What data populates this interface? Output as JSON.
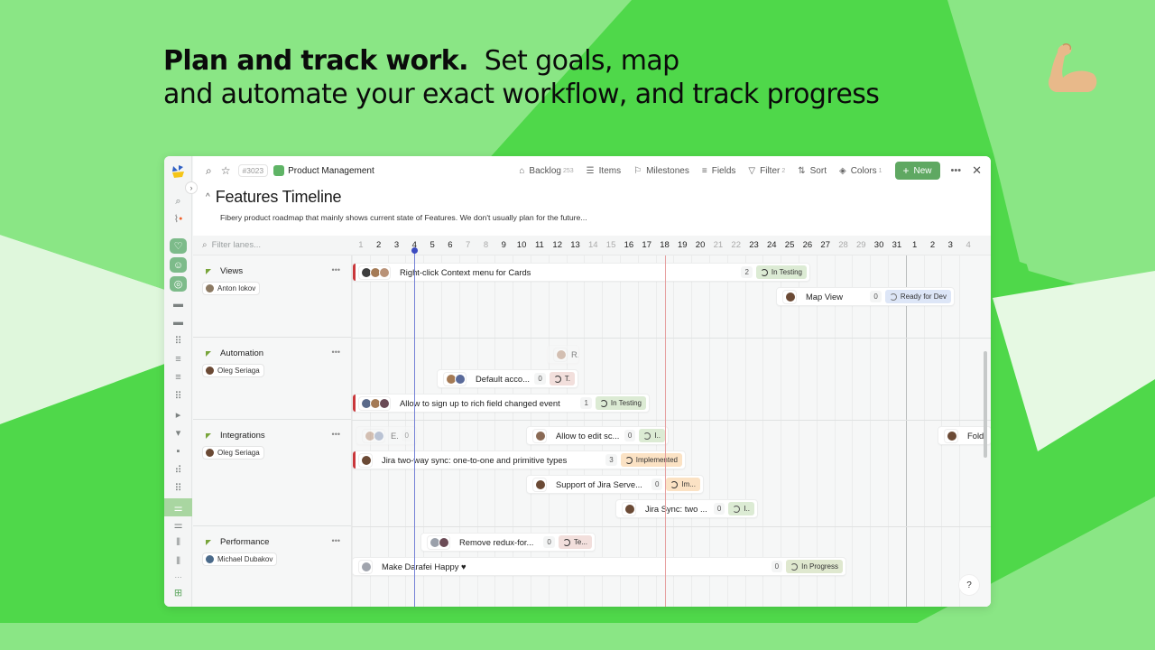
{
  "hero": {
    "bold": "Plan and track work.",
    "line1_rest": "  Set goals, map",
    "line2": "and automate your exact workflow, and track progress",
    "emoji": "flexed-biceps"
  },
  "topbar": {
    "id_chip": "#3023",
    "space": "Product Management",
    "tools": [
      {
        "label": "Backlog",
        "count": "253",
        "icon": "inbox-icon"
      },
      {
        "label": "Items",
        "count": "",
        "icon": "items-icon"
      },
      {
        "label": "Milestones",
        "count": "",
        "icon": "flag-icon"
      },
      {
        "label": "Fields",
        "count": "",
        "icon": "fields-icon"
      },
      {
        "label": "Filter",
        "count": "2",
        "icon": "filter-icon"
      },
      {
        "label": "Sort",
        "count": "",
        "icon": "sort-icon"
      },
      {
        "label": "Colors",
        "count": "1",
        "icon": "paint-bucket-icon"
      }
    ],
    "new_label": "New",
    "accent": "#5fa862"
  },
  "view": {
    "title": "Features Timeline",
    "description": "Fibery product roadmap that mainly shows current state of Features. We don't usually plan for the future..."
  },
  "timeline": {
    "filter_placeholder": "Filter lanes...",
    "days": [
      {
        "d": "1",
        "w": true
      },
      {
        "d": "2",
        "w": false
      },
      {
        "d": "3",
        "w": false
      },
      {
        "d": "4",
        "w": false
      },
      {
        "d": "5",
        "w": false
      },
      {
        "d": "6",
        "w": false
      },
      {
        "d": "7",
        "w": true
      },
      {
        "d": "8",
        "w": true
      },
      {
        "d": "9",
        "w": false
      },
      {
        "d": "10",
        "w": false
      },
      {
        "d": "11",
        "w": false
      },
      {
        "d": "12",
        "w": false
      },
      {
        "d": "13",
        "w": false
      },
      {
        "d": "14",
        "w": true
      },
      {
        "d": "15",
        "w": true
      },
      {
        "d": "16",
        "w": false
      },
      {
        "d": "17",
        "w": false
      },
      {
        "d": "18",
        "w": false
      },
      {
        "d": "19",
        "w": false
      },
      {
        "d": "20",
        "w": false
      },
      {
        "d": "21",
        "w": true
      },
      {
        "d": "22",
        "w": true
      },
      {
        "d": "23",
        "w": false
      },
      {
        "d": "24",
        "w": false
      },
      {
        "d": "25",
        "w": false
      },
      {
        "d": "26",
        "w": false
      },
      {
        "d": "27",
        "w": false
      },
      {
        "d": "28",
        "w": true
      },
      {
        "d": "29",
        "w": true
      },
      {
        "d": "30",
        "w": false
      },
      {
        "d": "31",
        "w": false
      },
      {
        "d": "1",
        "w": false
      },
      {
        "d": "2",
        "w": false
      },
      {
        "d": "3",
        "w": false
      },
      {
        "d": "4",
        "w": true
      }
    ],
    "today_day_index": 3.5,
    "lanes": [
      {
        "name": "Views",
        "owner": "Anton Iokov"
      },
      {
        "name": "Automation",
        "owner": "Oleg Seriaga"
      },
      {
        "name": "Integrations",
        "owner": "Oleg Seriaga"
      },
      {
        "name": "Performance",
        "owner": "Michael Dubakov"
      }
    ],
    "cards": [
      {
        "title": "Right-click Context menu for Cards",
        "count": "2",
        "status": "In Testing"
      },
      {
        "title": "Map View",
        "count": "0",
        "status": "Ready for Dev"
      },
      {
        "title": "R.",
        "count": "",
        "status": ""
      },
      {
        "title": "Default acco...",
        "count": "0",
        "status": "T."
      },
      {
        "title": "Allow to sign up to rich field changed event",
        "count": "1",
        "status": "In Testing"
      },
      {
        "title": "E.",
        "count": "0",
        "status": ""
      },
      {
        "title": "Allow to edit sc...",
        "count": "0",
        "status": "I.."
      },
      {
        "title": "Fold",
        "count": "",
        "status": ""
      },
      {
        "title": "Jira two-way sync: one-to-one and primitive types",
        "count": "3",
        "status": "Implemented"
      },
      {
        "title": "Support of Jira Serve...",
        "count": "0",
        "status": "Im..."
      },
      {
        "title": "Jira Sync: two ...",
        "count": "0",
        "status": "I.."
      },
      {
        "title": "Remove redux-for...",
        "count": "0",
        "status": "Te..."
      },
      {
        "title": "Make Darafei Happy ♥",
        "count": "0",
        "status": "In Progress"
      }
    ]
  },
  "help_label": "?"
}
